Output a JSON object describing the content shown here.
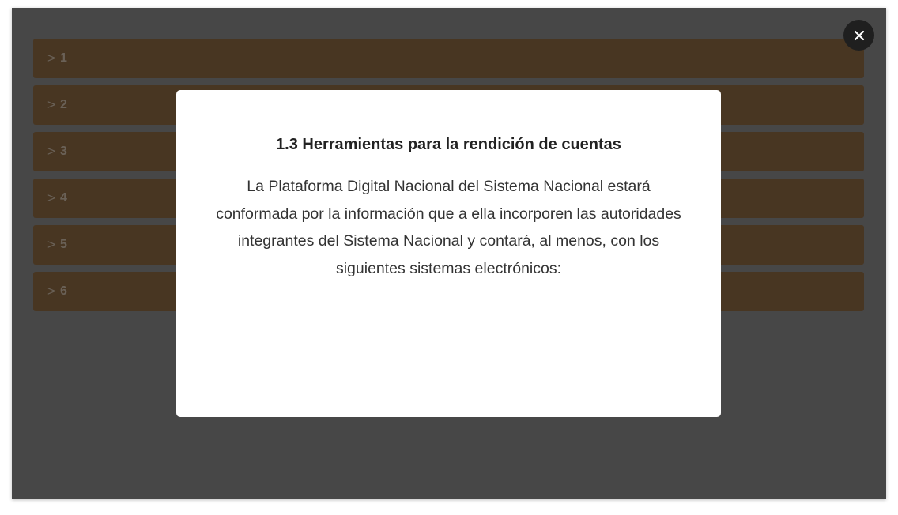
{
  "accordion": {
    "items": [
      {
        "chevron": ">",
        "label": "1"
      },
      {
        "chevron": ">",
        "label": "2"
      },
      {
        "chevron": ">",
        "label": "3"
      },
      {
        "chevron": ">",
        "label": "4"
      },
      {
        "chevron": ">",
        "label": "5"
      },
      {
        "chevron": ">",
        "label": "6"
      }
    ]
  },
  "modal": {
    "title": "1.3 Herramientas para la rendición de cuentas",
    "body": "La Plataforma Digital Nacional del Sistema Nacional estará conformada por la información que a ella incorporen las autoridades integrantes del Sistema Nacional y contará, al menos, con los siguientes sistemas electrónicos:"
  },
  "close_button": {
    "icon": "close-icon"
  },
  "colors": {
    "accordion_bg": "#7c5d3c",
    "overlay": "#000000",
    "modal_bg": "#ffffff",
    "close_bg": "#1f1f1f"
  }
}
